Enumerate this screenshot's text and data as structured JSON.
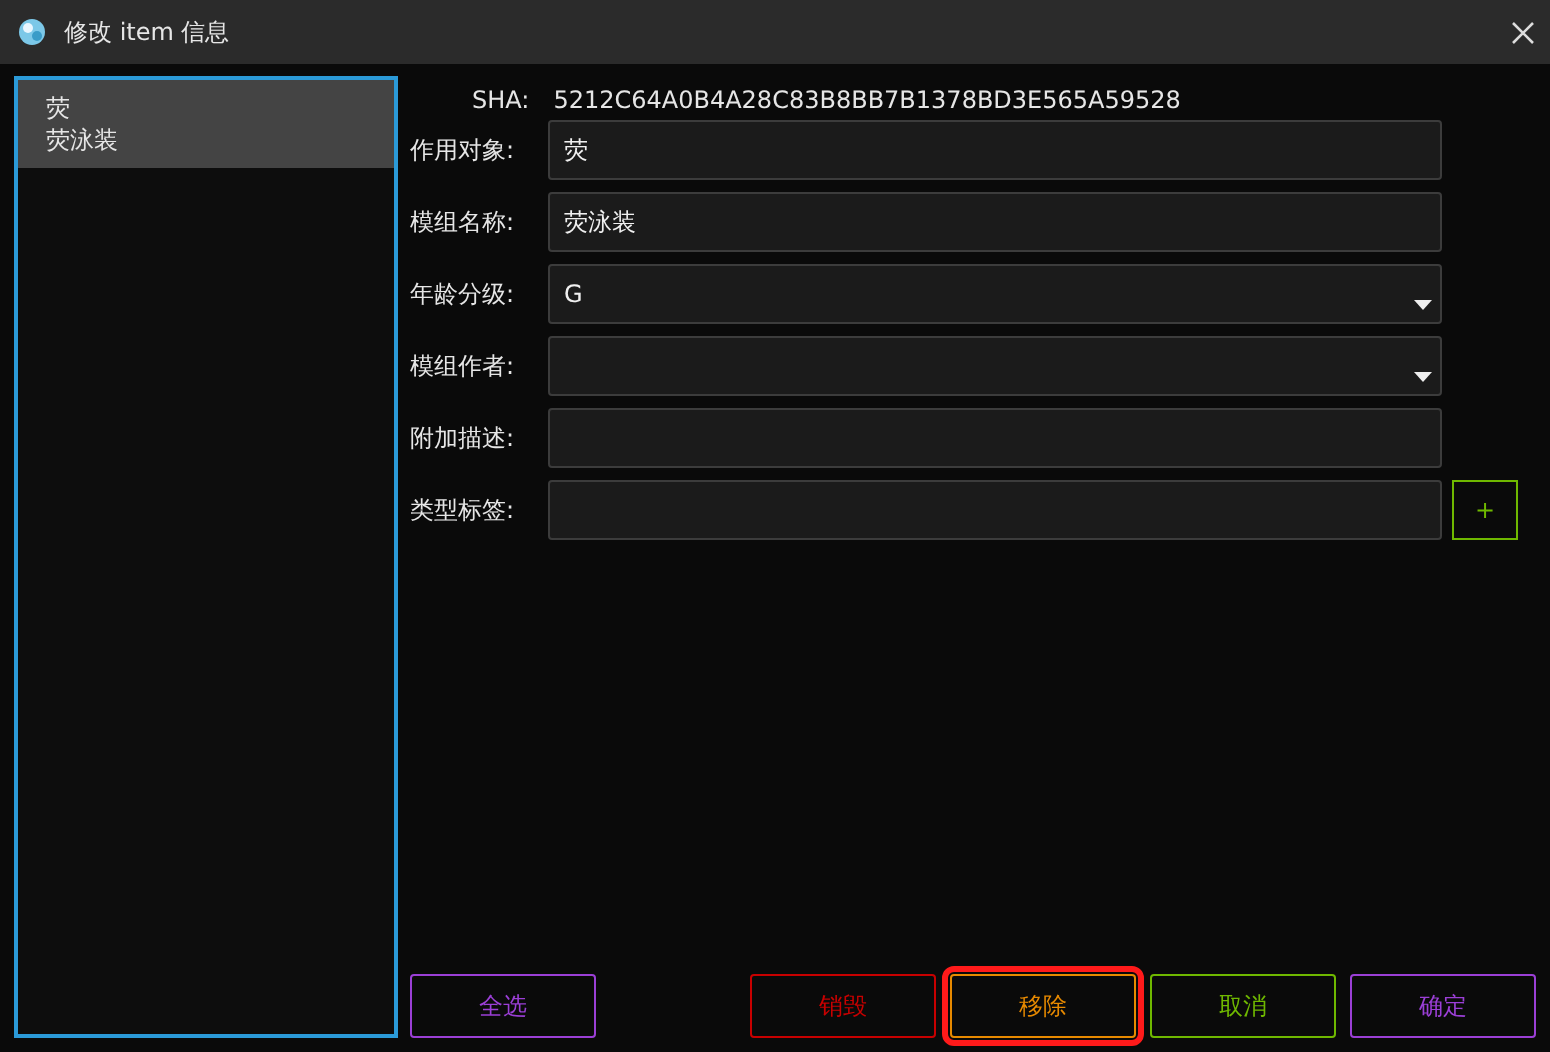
{
  "window": {
    "title": "修改 item 信息"
  },
  "items": [
    {
      "lines": [
        "荧",
        "荧泳装"
      ],
      "selected": true
    }
  ],
  "sha": {
    "label": "SHA:",
    "value": "5212C64A0B4A28C83B8BB7B1378BD3E565A59528"
  },
  "fields": [
    {
      "label": "作用对象:",
      "kind": "text",
      "value": "荧"
    },
    {
      "label": "模组名称:",
      "kind": "text",
      "value": "荧泳装"
    },
    {
      "label": "年龄分级:",
      "kind": "dropdown",
      "value": "G"
    },
    {
      "label": "模组作者:",
      "kind": "dropdown"
    },
    {
      "label": "附加描述:",
      "kind": "text"
    },
    {
      "label": "类型标签:",
      "kind": "tags",
      "add": "+"
    }
  ],
  "buttons": [
    {
      "label": "全选",
      "color": "#9b3fd6",
      "focused": false
    },
    {
      "label": "销毁",
      "color": "#c80000",
      "focused": false
    },
    {
      "label": "移除",
      "color": "#e88a00",
      "focused": true
    },
    {
      "label": "取消",
      "color": "#6fb800",
      "focused": false
    },
    {
      "label": "确定",
      "color": "#9b3fd6",
      "focused": false
    }
  ]
}
